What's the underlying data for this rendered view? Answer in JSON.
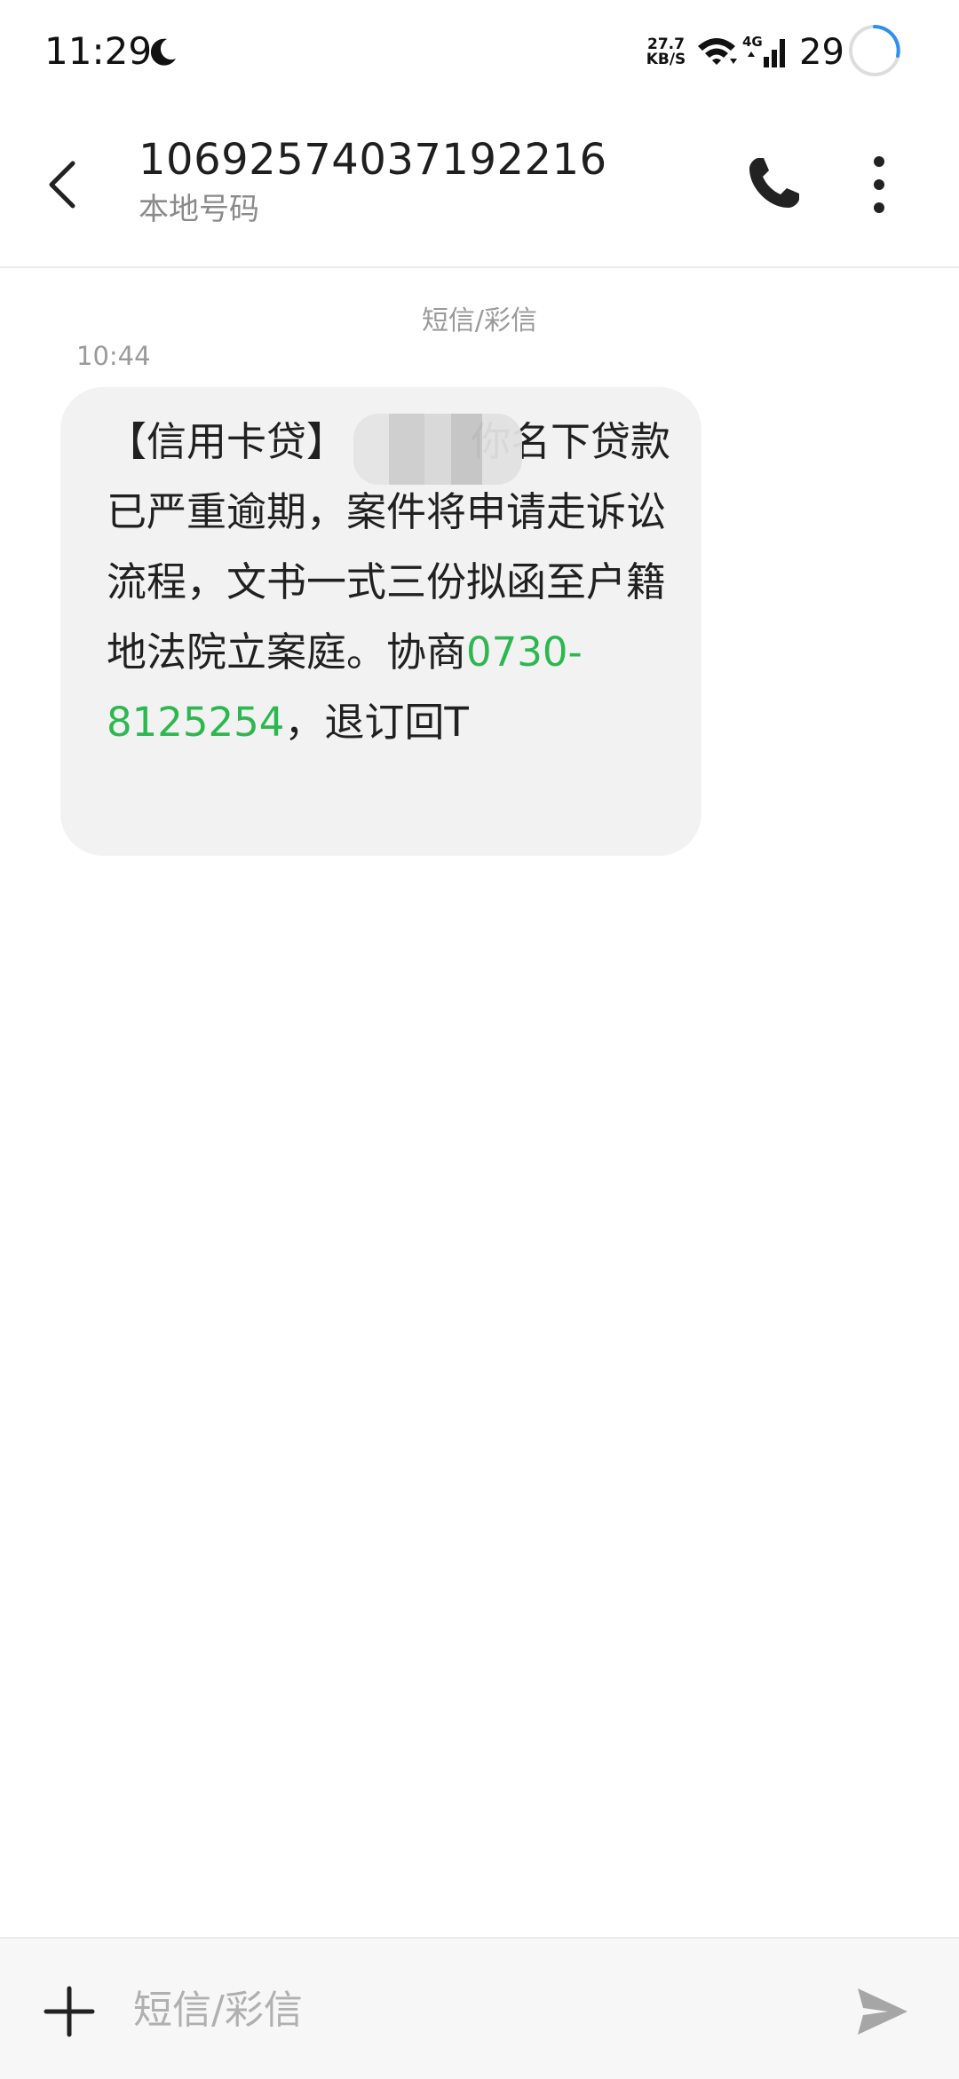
{
  "status_bar": {
    "time": "11:29",
    "net_speed_value": "27.7",
    "net_speed_unit": "KB/S",
    "network_type": "4G",
    "battery": "29",
    "icons": [
      "moon-icon",
      "wifi-icon",
      "cellular-signal-icon",
      "battery-ring-icon"
    ]
  },
  "header": {
    "number": "10692574037192216",
    "subtitle": "本地号码",
    "icons": [
      "back-arrow-icon",
      "phone-call-icon",
      "more-vert-icon"
    ]
  },
  "conversation": {
    "channel_label": "短信/彩信",
    "messages": [
      {
        "time": "10:44",
        "text_before_redaction": "【信用卡贷】",
        "text_after_redaction": "你名下贷款已严重逾期，案件将申请走诉讼流程，文书一式三份拟函至户籍地法院立案庭。协商",
        "phone": "0730-8125254",
        "text_end": "，退订回T"
      }
    ]
  },
  "compose": {
    "placeholder": "短信/彩信",
    "value": "",
    "icons": [
      "plus-icon",
      "send-icon"
    ]
  },
  "colors": {
    "link": "#2db84f",
    "bubble": "#f2f2f2",
    "battery_ring": "#2f8ff0",
    "send_icon": "#a6a6a6"
  }
}
